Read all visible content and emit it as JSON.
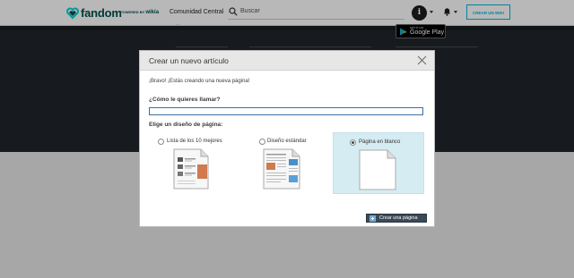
{
  "nav": {
    "brand": "fandom",
    "powered_by": "POWERED BY",
    "powered_brand": "wikia",
    "community_link": "Comunidad Central",
    "search_placeholder": "Buscar",
    "avatar_letter": "i",
    "create_wiki": "CREAR UN WIKI"
  },
  "header_band": {
    "fragment_text": "...",
    "google_play_small": "GET IT ON",
    "google_play_big": "Google Play"
  },
  "modal": {
    "title": "Crear un nuevo artículo",
    "intro": "¡Bravo! ¡Estás creando una nueva página!",
    "name_label": "¿Cómo le quieres llamar?",
    "name_value": "",
    "layout_label": "Elige un diseño de página:",
    "options": [
      {
        "label": "Lista de los 10 mejores",
        "selected": false
      },
      {
        "label": "Diseño estándar",
        "selected": false
      },
      {
        "label": "Página en blanco",
        "selected": true
      }
    ],
    "create_button": "Crear una página"
  },
  "colors": {
    "brand_teal": "#00514b",
    "accent_cyan": "#00b7e0",
    "dark_band": "#20262b",
    "selected_option": "#d5ecf3",
    "primary_button": "#3b4a58"
  }
}
